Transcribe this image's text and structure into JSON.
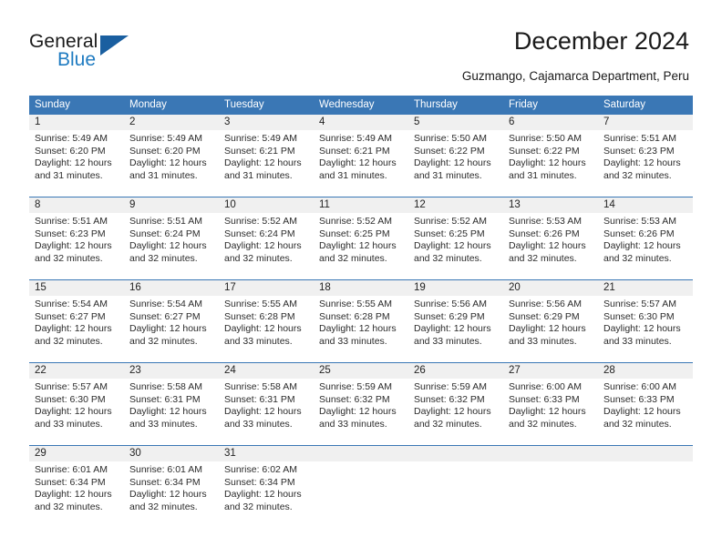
{
  "brand": {
    "name_part1": "General",
    "name_part2": "Blue",
    "triangle_icon": "triangle-logo-icon",
    "colors": {
      "blue": "#1f7bc1",
      "dark_blue": "#1a5fa0",
      "header_blue": "#3a77b5",
      "daynum_gray": "#f0f0f0"
    }
  },
  "header": {
    "title": "December 2024",
    "subtitle": "Guzmango, Cajamarca Department, Peru"
  },
  "calendar": {
    "weekdays": [
      "Sunday",
      "Monday",
      "Tuesday",
      "Wednesday",
      "Thursday",
      "Friday",
      "Saturday"
    ],
    "weeks": [
      {
        "days": [
          {
            "num": "1",
            "sunrise": "Sunrise: 5:49 AM",
            "sunset": "Sunset: 6:20 PM",
            "daylight1": "Daylight: 12 hours",
            "daylight2": "and 31 minutes."
          },
          {
            "num": "2",
            "sunrise": "Sunrise: 5:49 AM",
            "sunset": "Sunset: 6:20 PM",
            "daylight1": "Daylight: 12 hours",
            "daylight2": "and 31 minutes."
          },
          {
            "num": "3",
            "sunrise": "Sunrise: 5:49 AM",
            "sunset": "Sunset: 6:21 PM",
            "daylight1": "Daylight: 12 hours",
            "daylight2": "and 31 minutes."
          },
          {
            "num": "4",
            "sunrise": "Sunrise: 5:49 AM",
            "sunset": "Sunset: 6:21 PM",
            "daylight1": "Daylight: 12 hours",
            "daylight2": "and 31 minutes."
          },
          {
            "num": "5",
            "sunrise": "Sunrise: 5:50 AM",
            "sunset": "Sunset: 6:22 PM",
            "daylight1": "Daylight: 12 hours",
            "daylight2": "and 31 minutes."
          },
          {
            "num": "6",
            "sunrise": "Sunrise: 5:50 AM",
            "sunset": "Sunset: 6:22 PM",
            "daylight1": "Daylight: 12 hours",
            "daylight2": "and 31 minutes."
          },
          {
            "num": "7",
            "sunrise": "Sunrise: 5:51 AM",
            "sunset": "Sunset: 6:23 PM",
            "daylight1": "Daylight: 12 hours",
            "daylight2": "and 32 minutes."
          }
        ]
      },
      {
        "days": [
          {
            "num": "8",
            "sunrise": "Sunrise: 5:51 AM",
            "sunset": "Sunset: 6:23 PM",
            "daylight1": "Daylight: 12 hours",
            "daylight2": "and 32 minutes."
          },
          {
            "num": "9",
            "sunrise": "Sunrise: 5:51 AM",
            "sunset": "Sunset: 6:24 PM",
            "daylight1": "Daylight: 12 hours",
            "daylight2": "and 32 minutes."
          },
          {
            "num": "10",
            "sunrise": "Sunrise: 5:52 AM",
            "sunset": "Sunset: 6:24 PM",
            "daylight1": "Daylight: 12 hours",
            "daylight2": "and 32 minutes."
          },
          {
            "num": "11",
            "sunrise": "Sunrise: 5:52 AM",
            "sunset": "Sunset: 6:25 PM",
            "daylight1": "Daylight: 12 hours",
            "daylight2": "and 32 minutes."
          },
          {
            "num": "12",
            "sunrise": "Sunrise: 5:52 AM",
            "sunset": "Sunset: 6:25 PM",
            "daylight1": "Daylight: 12 hours",
            "daylight2": "and 32 minutes."
          },
          {
            "num": "13",
            "sunrise": "Sunrise: 5:53 AM",
            "sunset": "Sunset: 6:26 PM",
            "daylight1": "Daylight: 12 hours",
            "daylight2": "and 32 minutes."
          },
          {
            "num": "14",
            "sunrise": "Sunrise: 5:53 AM",
            "sunset": "Sunset: 6:26 PM",
            "daylight1": "Daylight: 12 hours",
            "daylight2": "and 32 minutes."
          }
        ]
      },
      {
        "days": [
          {
            "num": "15",
            "sunrise": "Sunrise: 5:54 AM",
            "sunset": "Sunset: 6:27 PM",
            "daylight1": "Daylight: 12 hours",
            "daylight2": "and 32 minutes."
          },
          {
            "num": "16",
            "sunrise": "Sunrise: 5:54 AM",
            "sunset": "Sunset: 6:27 PM",
            "daylight1": "Daylight: 12 hours",
            "daylight2": "and 32 minutes."
          },
          {
            "num": "17",
            "sunrise": "Sunrise: 5:55 AM",
            "sunset": "Sunset: 6:28 PM",
            "daylight1": "Daylight: 12 hours",
            "daylight2": "and 33 minutes."
          },
          {
            "num": "18",
            "sunrise": "Sunrise: 5:55 AM",
            "sunset": "Sunset: 6:28 PM",
            "daylight1": "Daylight: 12 hours",
            "daylight2": "and 33 minutes."
          },
          {
            "num": "19",
            "sunrise": "Sunrise: 5:56 AM",
            "sunset": "Sunset: 6:29 PM",
            "daylight1": "Daylight: 12 hours",
            "daylight2": "and 33 minutes."
          },
          {
            "num": "20",
            "sunrise": "Sunrise: 5:56 AM",
            "sunset": "Sunset: 6:29 PM",
            "daylight1": "Daylight: 12 hours",
            "daylight2": "and 33 minutes."
          },
          {
            "num": "21",
            "sunrise": "Sunrise: 5:57 AM",
            "sunset": "Sunset: 6:30 PM",
            "daylight1": "Daylight: 12 hours",
            "daylight2": "and 33 minutes."
          }
        ]
      },
      {
        "days": [
          {
            "num": "22",
            "sunrise": "Sunrise: 5:57 AM",
            "sunset": "Sunset: 6:30 PM",
            "daylight1": "Daylight: 12 hours",
            "daylight2": "and 33 minutes."
          },
          {
            "num": "23",
            "sunrise": "Sunrise: 5:58 AM",
            "sunset": "Sunset: 6:31 PM",
            "daylight1": "Daylight: 12 hours",
            "daylight2": "and 33 minutes."
          },
          {
            "num": "24",
            "sunrise": "Sunrise: 5:58 AM",
            "sunset": "Sunset: 6:31 PM",
            "daylight1": "Daylight: 12 hours",
            "daylight2": "and 33 minutes."
          },
          {
            "num": "25",
            "sunrise": "Sunrise: 5:59 AM",
            "sunset": "Sunset: 6:32 PM",
            "daylight1": "Daylight: 12 hours",
            "daylight2": "and 33 minutes."
          },
          {
            "num": "26",
            "sunrise": "Sunrise: 5:59 AM",
            "sunset": "Sunset: 6:32 PM",
            "daylight1": "Daylight: 12 hours",
            "daylight2": "and 32 minutes."
          },
          {
            "num": "27",
            "sunrise": "Sunrise: 6:00 AM",
            "sunset": "Sunset: 6:33 PM",
            "daylight1": "Daylight: 12 hours",
            "daylight2": "and 32 minutes."
          },
          {
            "num": "28",
            "sunrise": "Sunrise: 6:00 AM",
            "sunset": "Sunset: 6:33 PM",
            "daylight1": "Daylight: 12 hours",
            "daylight2": "and 32 minutes."
          }
        ]
      },
      {
        "days": [
          {
            "num": "29",
            "sunrise": "Sunrise: 6:01 AM",
            "sunset": "Sunset: 6:34 PM",
            "daylight1": "Daylight: 12 hours",
            "daylight2": "and 32 minutes."
          },
          {
            "num": "30",
            "sunrise": "Sunrise: 6:01 AM",
            "sunset": "Sunset: 6:34 PM",
            "daylight1": "Daylight: 12 hours",
            "daylight2": "and 32 minutes."
          },
          {
            "num": "31",
            "sunrise": "Sunrise: 6:02 AM",
            "sunset": "Sunset: 6:34 PM",
            "daylight1": "Daylight: 12 hours",
            "daylight2": "and 32 minutes."
          },
          {
            "num": "",
            "sunrise": "",
            "sunset": "",
            "daylight1": "",
            "daylight2": ""
          },
          {
            "num": "",
            "sunrise": "",
            "sunset": "",
            "daylight1": "",
            "daylight2": ""
          },
          {
            "num": "",
            "sunrise": "",
            "sunset": "",
            "daylight1": "",
            "daylight2": ""
          },
          {
            "num": "",
            "sunrise": "",
            "sunset": "",
            "daylight1": "",
            "daylight2": ""
          }
        ]
      }
    ]
  }
}
